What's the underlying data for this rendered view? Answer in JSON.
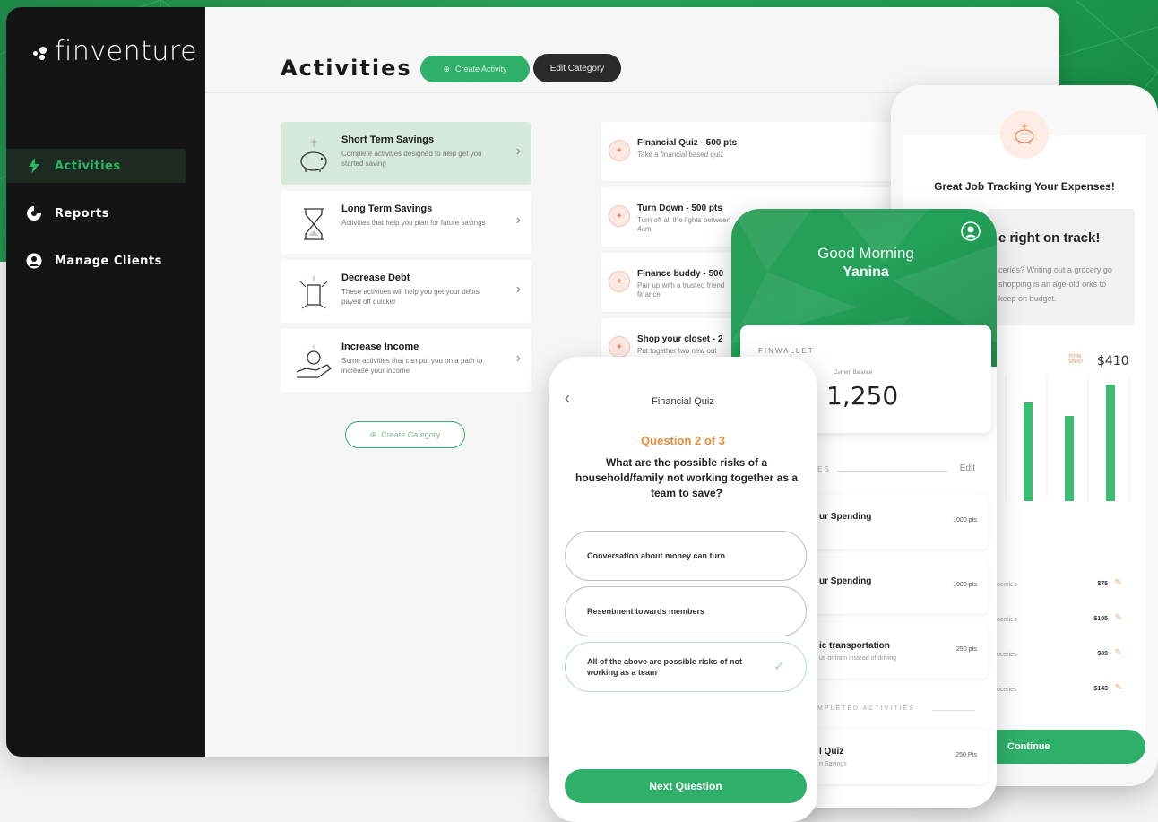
{
  "brand": {
    "name": "finventure"
  },
  "sidebar": {
    "items": [
      {
        "label": "Activities",
        "active": true
      },
      {
        "label": "Reports",
        "active": false
      },
      {
        "label": "Manage Clients",
        "active": false
      }
    ]
  },
  "header": {
    "title": "Activities",
    "create_activity": "Create Activity",
    "edit_category": "Edit Category"
  },
  "categories": [
    {
      "title": "Short Term Savings",
      "desc": "Complete activities designed to help get you started saving",
      "icon": "piggy-bank-icon"
    },
    {
      "title": "Long Term Savings",
      "desc": "Activities that help you plan for future savings",
      "icon": "hourglass-icon"
    },
    {
      "title": "Decrease Debt",
      "desc": "These activities will help you get your debts payed off quicker",
      "icon": "debt-icon"
    },
    {
      "title": "Increase Income",
      "desc": "Some activities that can put you on a path to increase your income",
      "icon": "money-hand-icon"
    }
  ],
  "create_category": "Create Category",
  "activities": [
    {
      "title": "Financial Quiz - 500 pts",
      "desc": "Take a financial based quiz"
    },
    {
      "title": "Turn Down - 500 pts",
      "desc": "Turn off all the lights between 4am"
    },
    {
      "title": "Finance buddy - 500",
      "desc": "Pair up with a trusted friend finance"
    },
    {
      "title": "Shop your closet - 2",
      "desc": "Put together two new out"
    }
  ],
  "quiz": {
    "title": "Financial Quiz",
    "question_number": "Question 2 of 3",
    "question": "What are the possible risks of a household/family not working together as a team to save?",
    "options": [
      "Conversation about money can turn",
      "Resentment towards members",
      "All of the above are possible risks of not working as a team"
    ],
    "next": "Next Question"
  },
  "home": {
    "greeting": "Good Morning",
    "name": "Yanina",
    "wallet_label": "FINWALLET",
    "balance_label": "Current Balance",
    "balance": "1,250",
    "section_label": "ES",
    "edit": "Edit",
    "activities": [
      {
        "title": "ur Spending",
        "desc": "",
        "pts": "1000 pts"
      },
      {
        "title": "ur Spending",
        "desc": "",
        "pts": "1000 pts"
      },
      {
        "title": "ic transportation",
        "desc": "us or train instead of driving",
        "pts": "250 pts"
      }
    ],
    "completed_label": "MPLETED ACTIVITIES",
    "completed": [
      {
        "title": "l Quiz",
        "desc": "n Savings",
        "pts": "250 Pts"
      }
    ]
  },
  "expenses": {
    "title": "Great Job Tracking Your Expenses!",
    "tip_title": "e right on track!",
    "tip_body": "ceries? Writing out a grocery go shopping is an age-old orks to keep on budget.",
    "total_label": "TOTAL SPENT",
    "total_value": "$410",
    "chart_data": {
      "type": "bar",
      "categories": [
        "",
        "",
        ""
      ],
      "values": [
        110,
        95,
        130
      ]
    },
    "rows": [
      {
        "name": "oceries",
        "amount": "$75"
      },
      {
        "name": "oceries",
        "amount": "$105"
      },
      {
        "name": "oceries",
        "amount": "$89"
      },
      {
        "name": "oceries",
        "amount": "$143"
      }
    ],
    "continue": "Continue"
  }
}
